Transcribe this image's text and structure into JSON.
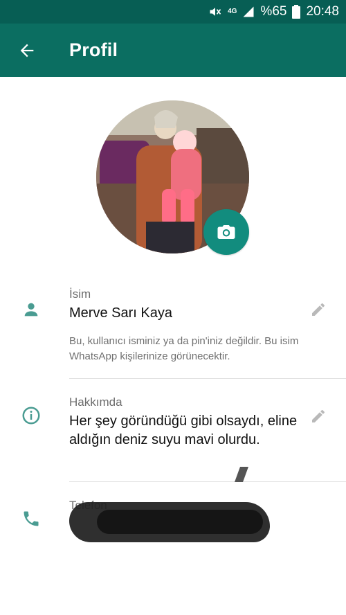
{
  "status_bar": {
    "network": "4G",
    "battery_label": "%65",
    "time": "20:48",
    "icons": [
      "mute-icon",
      "signal-icon",
      "battery-icon"
    ]
  },
  "header": {
    "title": "Profil",
    "back_icon": "arrow-left-icon"
  },
  "profile": {
    "camera_icon": "camera-icon",
    "name_label": "İsim",
    "name_value": "Merve Sarı Kaya",
    "name_help": "Bu, kullanıcı isminiz ya da pin'iniz değildir. Bu isim WhatsApp kişilerinize görünecektir.",
    "about_label": "Hakkımda",
    "about_value": "Her şey göründüğü gibi olsaydı, eline aldığın deniz suyu mavi olurdu.",
    "phone_label": "Telefon"
  },
  "colors": {
    "status_bar": "#075e54",
    "app_bar": "#0b6e61",
    "accent": "#128c7e",
    "icon_tint": "#4a9c92"
  }
}
